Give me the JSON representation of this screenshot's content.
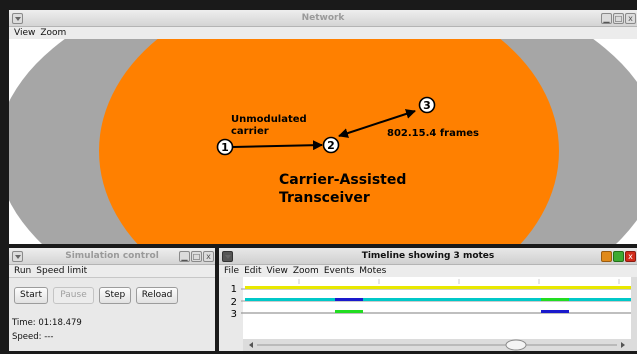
{
  "network": {
    "title": "Network",
    "menu": [
      "View",
      "Zoom"
    ],
    "motes": [
      {
        "label": "1"
      },
      {
        "label": "2"
      },
      {
        "label": "3"
      }
    ],
    "annotations": {
      "unmodulated_line1": "Unmodulated",
      "unmodulated_line2": "carrier",
      "frames": "802.15.4 frames",
      "transceiver_line1": "Carrier-Assisted",
      "transceiver_line2": "Transceiver"
    },
    "colors": {
      "range": "#ff8000",
      "interference": "#a0a0a0",
      "background": "#ffffff"
    }
  },
  "simulation": {
    "title": "Simulation control",
    "menu": [
      "Run",
      "Speed limit"
    ],
    "buttons": {
      "start": "Start",
      "pause": "Pause",
      "step": "Step",
      "reload": "Reload"
    },
    "time": "Time: 01:18.479",
    "speed": "Speed: ---"
  },
  "timeline": {
    "title": "Timeline showing 3 motes",
    "menu": [
      "File",
      "Edit",
      "View",
      "Zoom",
      "Events",
      "Motes"
    ],
    "rows": [
      "1",
      "2",
      "3"
    ],
    "colors": {
      "radio_on": "#e8e800",
      "rx": "#00c8c8",
      "tx_blue": "#1a1acc",
      "tx_green": "#22dd22",
      "line": "#999999"
    }
  }
}
